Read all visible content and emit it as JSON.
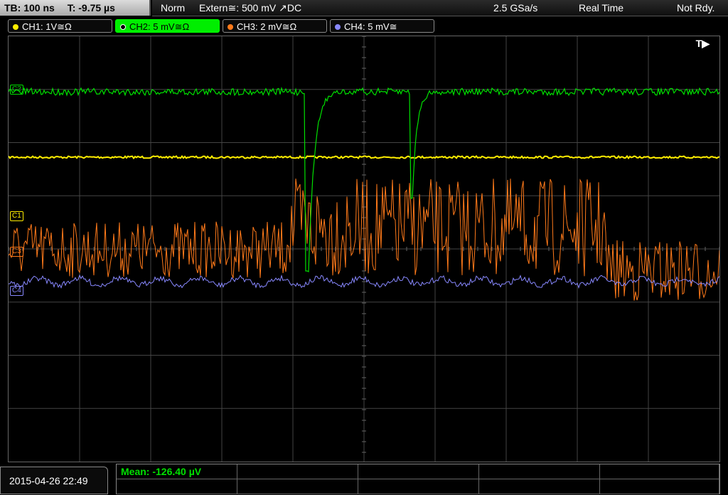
{
  "timebase": {
    "tb": "TB: 100 ns",
    "t": "T: -9.75 µs"
  },
  "status": {
    "mode": "Norm",
    "trigger": "Extern≅: 500 mV ↗DC",
    "rate": "2.5 GSa/s",
    "acq": "Real Time",
    "state": "Not Rdy."
  },
  "channels": [
    {
      "label": "CH1: 1V≅Ω",
      "color": "#ffee00"
    },
    {
      "label": "CH2: 5 mV≅Ω",
      "color": "#00e000"
    },
    {
      "label": "CH3: 2 mV≅Ω",
      "color": "#ff7a1a"
    },
    {
      "label": "CH4: 5 mV≅",
      "color": "#8888ff"
    }
  ],
  "markers": {
    "c1": "C1",
    "c3": "C3",
    "c4": "C4",
    "c2": "C2"
  },
  "trigger_icon": "T▶",
  "datetime": "2015-04-26 22:49",
  "measurement": {
    "mean": "Mean: -126.40 µV"
  },
  "colors": {
    "ch1": "#ffee00",
    "ch2": "#00e000",
    "ch3": "#ff7a1a",
    "ch4": "#8888ff",
    "grid": "#444444"
  }
}
